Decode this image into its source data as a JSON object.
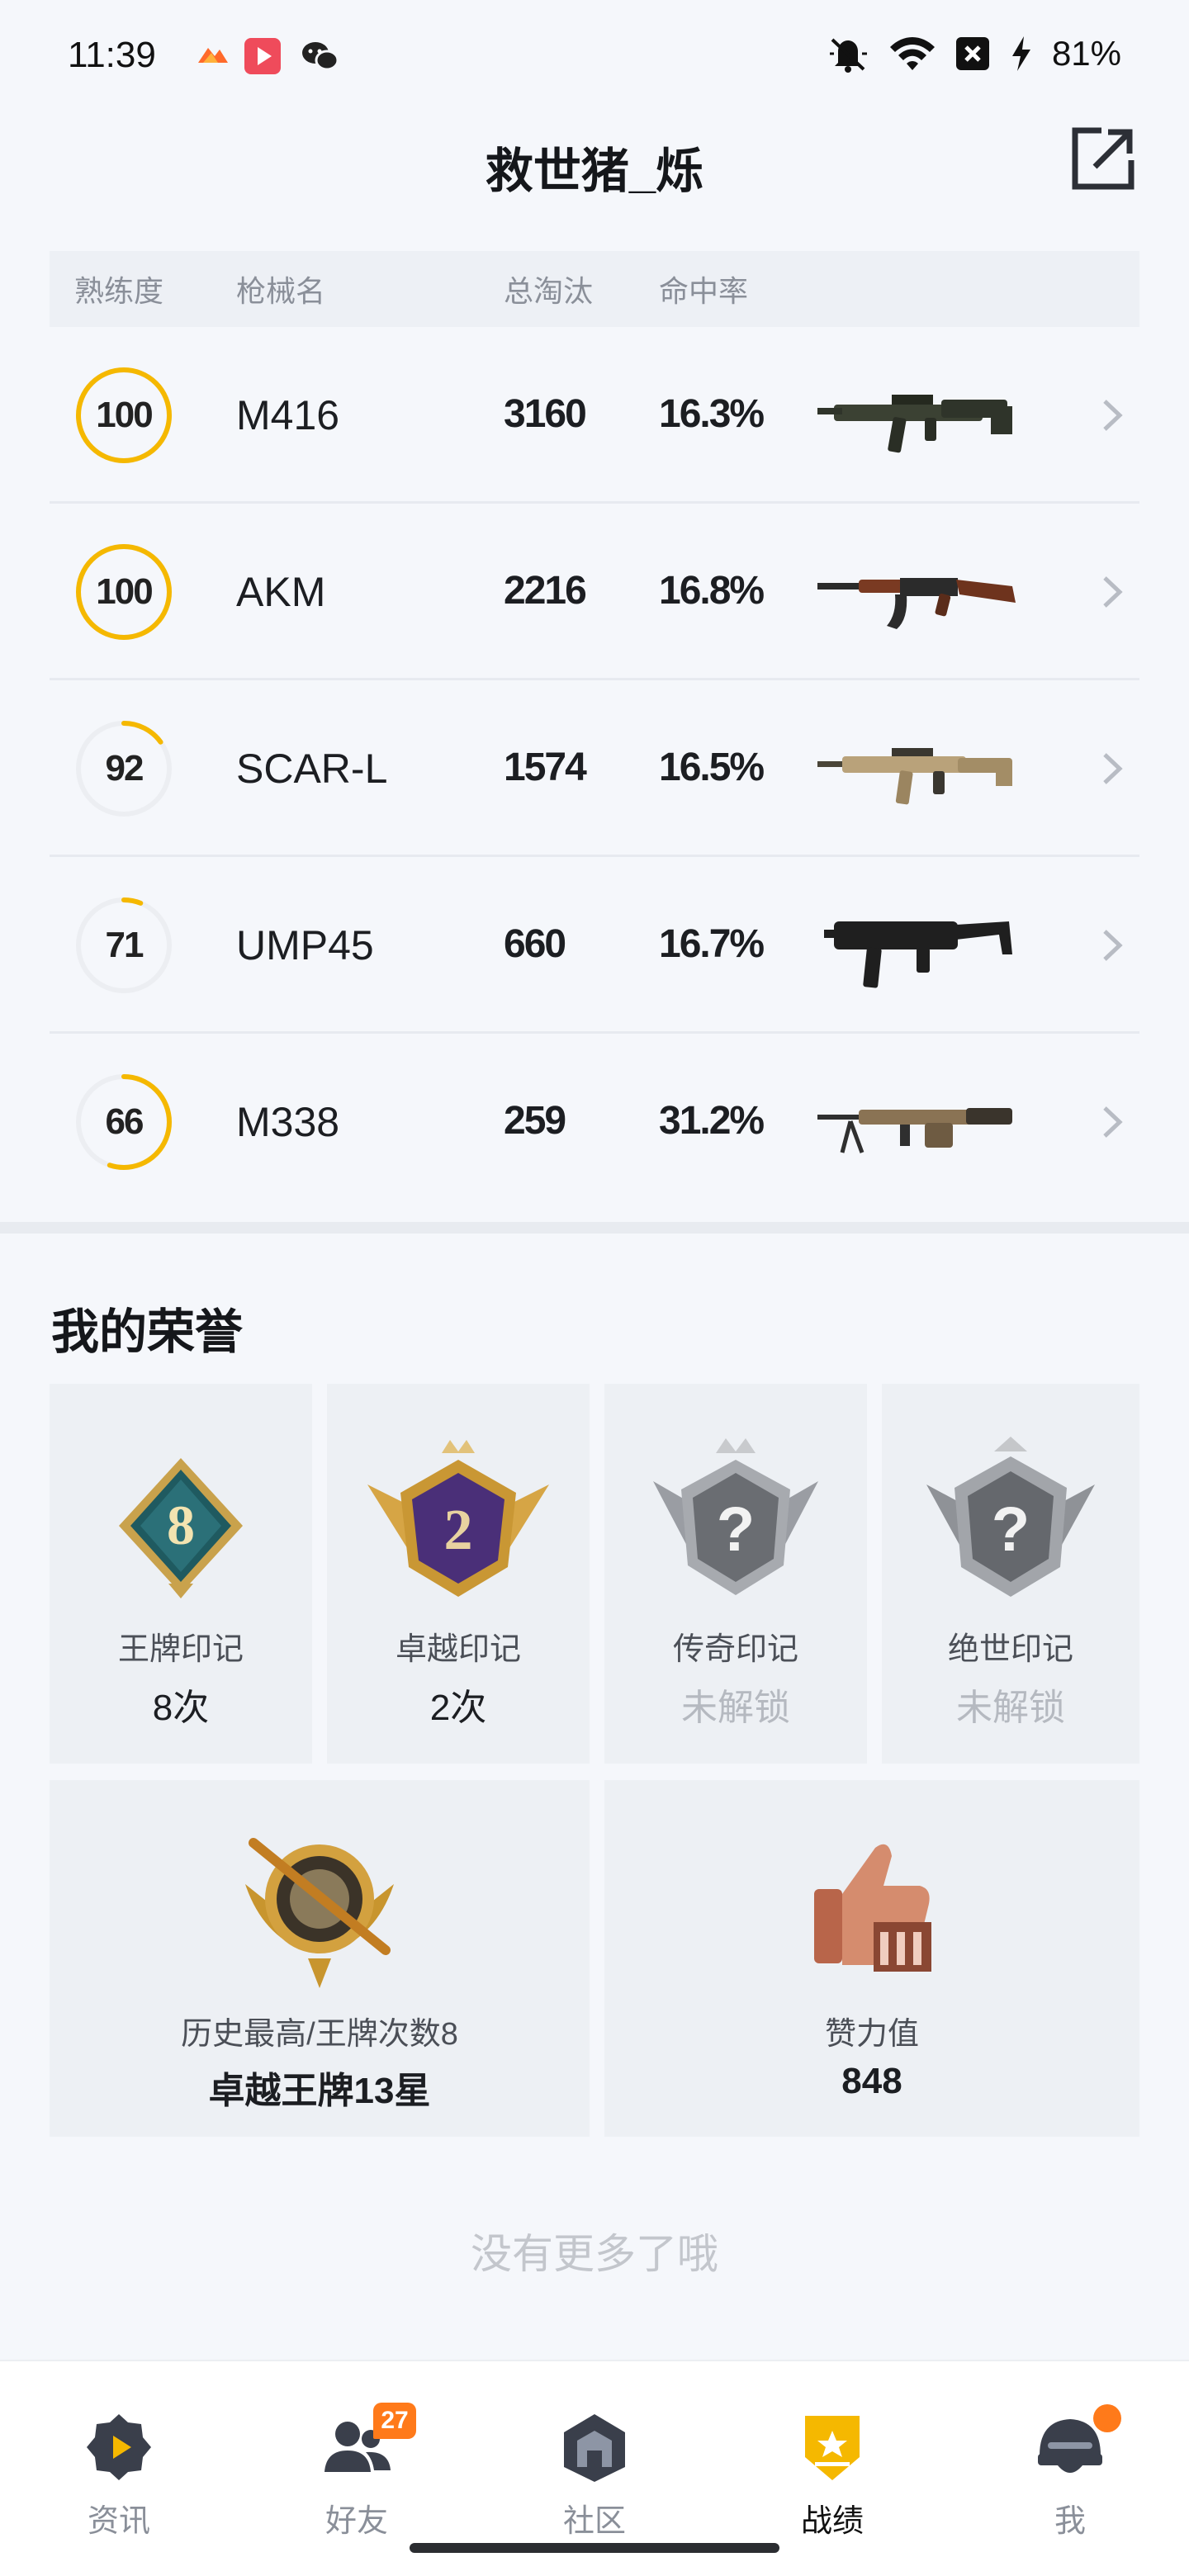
{
  "status_bar": {
    "time": "11:39",
    "battery": "81%",
    "icons": [
      "app-icon-orange",
      "video-app-icon",
      "wechat-icon",
      "mute-icon",
      "wifi-icon",
      "x-box-icon",
      "charging-icon"
    ]
  },
  "header": {
    "title": "救世猪_烁",
    "share_icon": "share-external-icon"
  },
  "weapons_table": {
    "columns": [
      "熟练度",
      "枪械名",
      "总淘汰",
      "命中率"
    ],
    "rows": [
      {
        "proficiency": "100",
        "proficiency_fraction": 1.0,
        "name": "M416",
        "kills": "3160",
        "hit_rate": "16.3%"
      },
      {
        "proficiency": "100",
        "proficiency_fraction": 1.0,
        "name": "AKM",
        "kills": "2216",
        "hit_rate": "16.8%"
      },
      {
        "proficiency": "92",
        "proficiency_fraction": 0.15,
        "name": "SCAR-L",
        "kills": "1574",
        "hit_rate": "16.5%"
      },
      {
        "proficiency": "71",
        "proficiency_fraction": 0.06,
        "name": "UMP45",
        "kills": "660",
        "hit_rate": "16.7%"
      },
      {
        "proficiency": "66",
        "proficiency_fraction": 0.55,
        "name": "M338",
        "kills": "259",
        "hit_rate": "31.2%"
      }
    ]
  },
  "honor": {
    "title": "我的荣誉",
    "cards": [
      {
        "label": "王牌印记",
        "value": "8次",
        "badge_text": "8",
        "locked": false
      },
      {
        "label": "卓越印记",
        "value": "2次",
        "badge_text": "2",
        "locked": false
      },
      {
        "label": "传奇印记",
        "value": "未解锁",
        "badge_text": "?",
        "locked": true
      },
      {
        "label": "绝世印记",
        "value": "未解锁",
        "badge_text": "?",
        "locked": true
      }
    ],
    "big_cards": [
      {
        "label": "历史最高/王牌次数8",
        "value": "卓越王牌13星"
      },
      {
        "label": "赞力值",
        "value": "848"
      }
    ]
  },
  "footer_note": "没有更多了哦",
  "bottom_nav": {
    "items": [
      {
        "label": "资讯",
        "icon": "news-icon"
      },
      {
        "label": "好友",
        "icon": "friends-icon",
        "badge": "27"
      },
      {
        "label": "社区",
        "icon": "community-icon"
      },
      {
        "label": "战绩",
        "icon": "record-icon",
        "active": true
      },
      {
        "label": "我",
        "icon": "helmet-icon"
      }
    ]
  },
  "colors": {
    "accent": "#f5b800",
    "background": "#f5f7fb",
    "card": "#edf0f4",
    "badge": "#ff7a1a"
  }
}
